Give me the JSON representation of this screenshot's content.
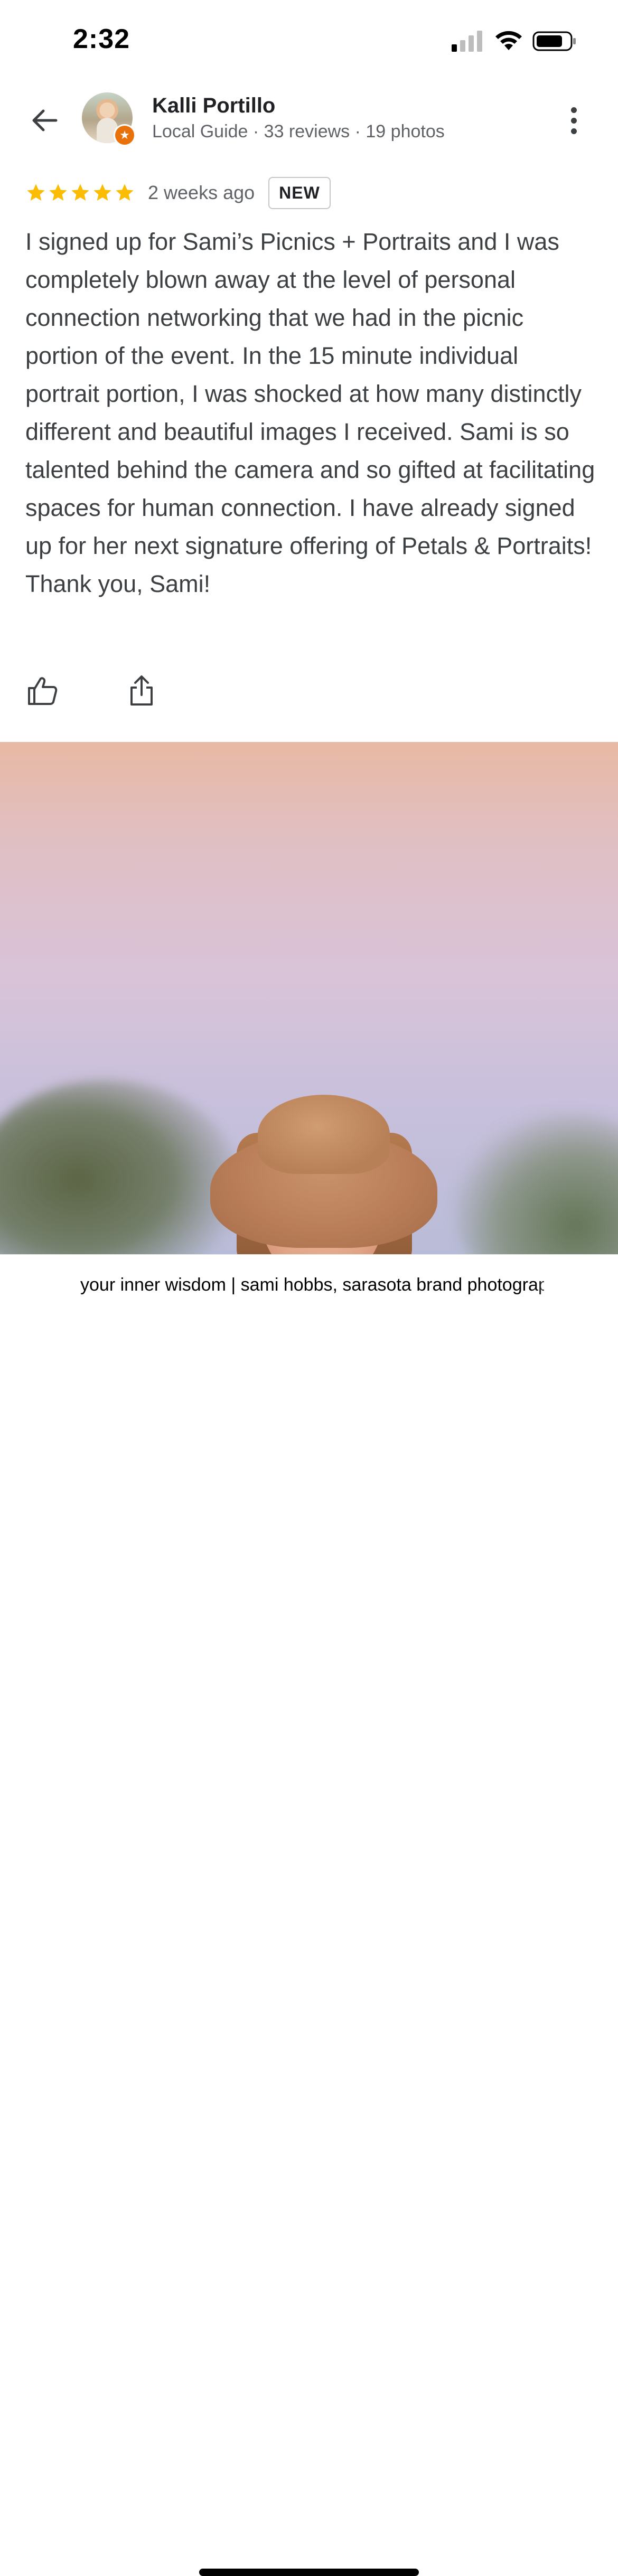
{
  "status_bar": {
    "time": "2:32",
    "icons": [
      "cellular-signal-icon",
      "wifi-icon",
      "battery-icon"
    ]
  },
  "header": {
    "back_icon": "arrow-left-icon",
    "reviewer_name": "Kalli Portillo",
    "reviewer_meta": "Local Guide · 33 reviews · 19 photos",
    "badge_icon": "local-guide-star-icon",
    "more_icon": "more-vertical-icon"
  },
  "review": {
    "rating": 5,
    "max_rating": 5,
    "date": "2 weeks ago",
    "badge": "NEW",
    "text": "I signed up for Sami’s Picnics + Portraits and I was completely blown away at the level of personal connection networking that we had in the picnic portion of the event. In the 15 minute individual portrait portion, I was shocked at how many distinctly different and beautiful images I received. Sami is so talented behind the camera and so gifted at facilitating spaces for human connection. I have already signed up for her next signature offering of Petals & Portraits! Thank you, Sami!"
  },
  "actions": {
    "like_icon": "thumbs-up-icon",
    "share_icon": "share-icon"
  },
  "browser": {
    "url_text": "your inner wisdom | sami hobbs, sarasota brand photographer",
    "lock_icon": "lock-icon",
    "search_icon": "search-icon"
  },
  "colors": {
    "star": "#fbbc04",
    "text_primary": "#202124",
    "text_secondary": "#5f6368",
    "badge_orange": "#e8710a"
  }
}
